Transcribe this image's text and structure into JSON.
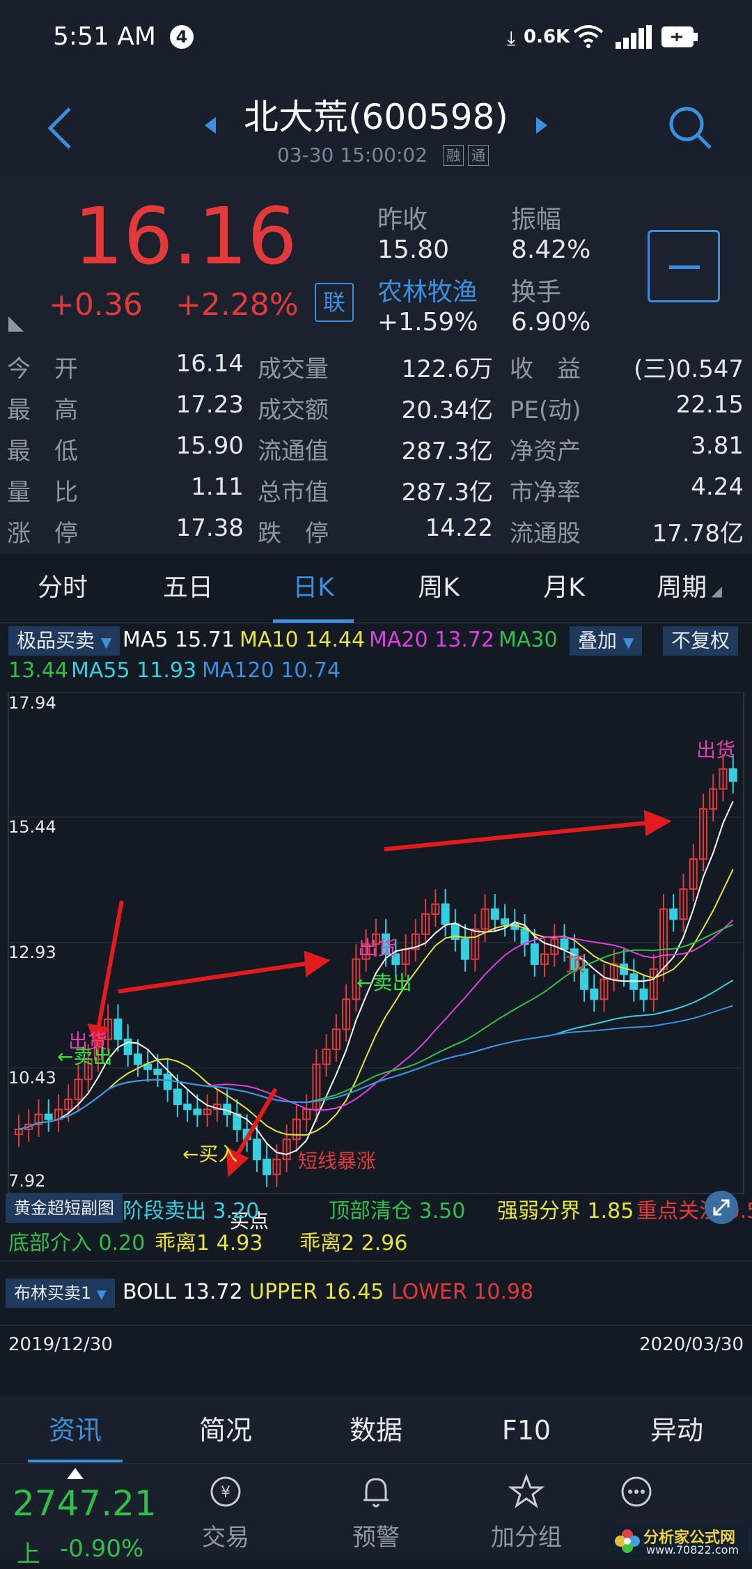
{
  "status": {
    "time": "5:51 AM",
    "notif_count": "4",
    "net_speed": "0.6K"
  },
  "header": {
    "title": "北大荒(600598)",
    "subtitle": "03-30 15:00:02",
    "badge1": "融",
    "badge2": "通"
  },
  "quote": {
    "price": "16.16",
    "change": "+0.36",
    "change_pct": "+2.28%",
    "lian": "联",
    "prev_close_label": "昨收",
    "prev_close": "15.80",
    "amplitude_label": "振幅",
    "amplitude": "8.42%",
    "sector": "农林牧渔",
    "sector_change": "+1.59%",
    "turnover_label": "换手",
    "turnover": "6.90%",
    "rows": [
      [
        {
          "l": "今　开",
          "v": "16.14"
        },
        {
          "l": "成交量",
          "v": "122.6万"
        },
        {
          "l": "收　益",
          "v": "(三)0.547"
        }
      ],
      [
        {
          "l": "最　高",
          "v": "17.23"
        },
        {
          "l": "成交额",
          "v": "20.34亿"
        },
        {
          "l": "PE(动)",
          "v": "22.15"
        }
      ],
      [
        {
          "l": "最　低",
          "v": "15.90"
        },
        {
          "l": "流通值",
          "v": "287.3亿"
        },
        {
          "l": "净资产",
          "v": "3.81"
        }
      ],
      [
        {
          "l": "量　比",
          "v": "1.11"
        },
        {
          "l": "总市值",
          "v": "287.3亿"
        },
        {
          "l": "市净率",
          "v": "4.24"
        }
      ],
      [
        {
          "l": "涨　停",
          "v": "17.38"
        },
        {
          "l": "跌　停",
          "v": "14.22"
        },
        {
          "l": "流通股",
          "v": "17.78亿"
        }
      ]
    ]
  },
  "tabs": [
    "分时",
    "五日",
    "日K",
    "周K",
    "月K",
    "周期"
  ],
  "chart": {
    "indicator_main": "极品买卖",
    "ma5_label": "MA5",
    "ma5": "15.71",
    "ma10_label": "MA10",
    "ma10": "14.44",
    "ma20_label": "MA20",
    "ma20": "13.72",
    "ma30_label": "MA30",
    "ma30": "13.44",
    "ma55_label": "MA55",
    "ma55": "11.93",
    "ma120_label": "MA120",
    "ma120": "10.74",
    "overlay": "叠加",
    "fuquan": "不复权",
    "y_ticks": [
      "17.94",
      "15.44",
      "12.93",
      "10.43",
      "7.92"
    ],
    "annotations": {
      "chuhuo1": "出货",
      "maichu1": "←卖出",
      "chuhuo2": "出货",
      "maichu2": "←卖出",
      "chuhuo3": "出货",
      "ding": "顶",
      "mairu": "←买入",
      "maidian": "买点",
      "baozhang": "短线暴涨"
    },
    "sub_indicator": "黄金超短副图",
    "sub_items": [
      {
        "name": "阶段卖出",
        "value": "3.20",
        "color": "#35d0e0"
      },
      {
        "name": "顶部清仓",
        "value": "3.50",
        "color": "#2fc04a"
      },
      {
        "name": "强弱分界",
        "value": "1.85",
        "color": "#e8e23a"
      },
      {
        "name": "重点关注",
        "value": "0.50",
        "color": "#e23a3a"
      },
      {
        "name": "底部介入",
        "value": "0.20",
        "color": "#2fc04a"
      },
      {
        "name": "乖离1",
        "value": "4.93",
        "color": "#e8e23a"
      },
      {
        "name": "乖离2",
        "value": "2.96",
        "color": "#e8e23a"
      }
    ],
    "boll_indicator": "布林买卖1",
    "boll_label": "BOLL",
    "boll": "13.72",
    "upper_label": "UPPER",
    "upper": "16.45",
    "lower_label": "LOWER",
    "lower": "10.98",
    "date_start": "2019/12/30",
    "date_end": "2020/03/30"
  },
  "bottom_tabs": [
    "资讯",
    "简况",
    "数据",
    "F10",
    "异动"
  ],
  "nav": {
    "index_value": "2747.21",
    "index_name": "上",
    "index_change": "-0.90%",
    "items": [
      "交易",
      "预警",
      "加分组"
    ],
    "watermark": "分析家公式网",
    "watermark_url": "www.70822.com"
  }
}
